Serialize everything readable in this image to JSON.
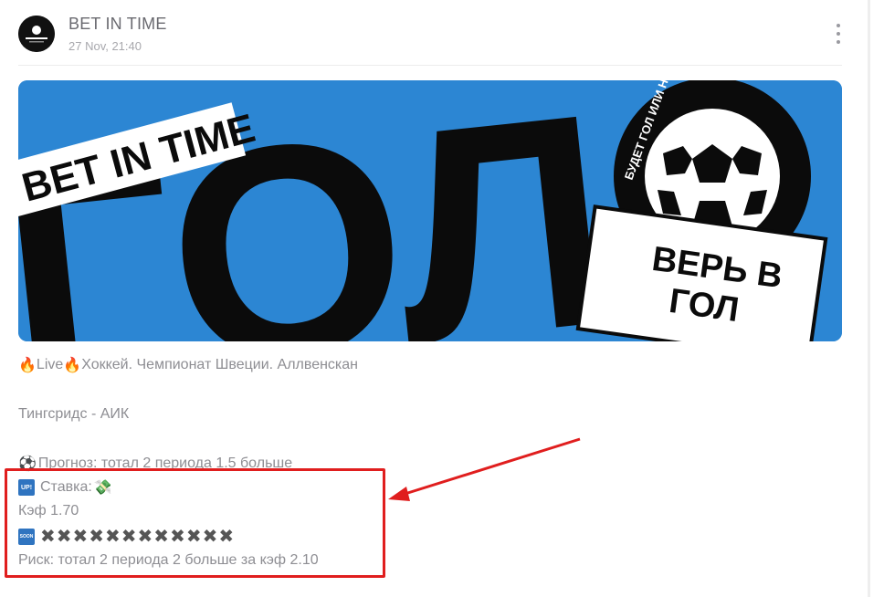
{
  "header": {
    "channel_name": "BET IN TIME",
    "post_time": "27 Nov, 21:40",
    "avatar_text": "BET IN TIME"
  },
  "banner": {
    "corner_label": "BET IN TIME",
    "big_text": "ГОЛ?",
    "ring_text": "БУДЕТ ГОЛ ИЛИ НЕТ, ТОПИ ДО КОНЦА",
    "sticker_line1": "ВЕРЬ В",
    "sticker_line2": "ГОЛ",
    "background_color": "#2c86d3"
  },
  "post": {
    "line1_live": "Live",
    "line1_text": "Хоккей. Чемпионат Швеции. Аллвенскан",
    "match": "Тингсридс - АИК",
    "forecast": "Прогноз: тотал 2 периода 1.5 больше",
    "stake_badge": "UP!",
    "stake_label": "Ставка:",
    "coef": "Кэф 1.70",
    "soon_badge": "SOON",
    "crosses": "✖✖✖✖✖✖✖✖✖✖✖✖",
    "risk": "Риск: тотал 2 периода 2 больше за кэф 2.10"
  },
  "annotation": {
    "color": "#e01e1e"
  }
}
